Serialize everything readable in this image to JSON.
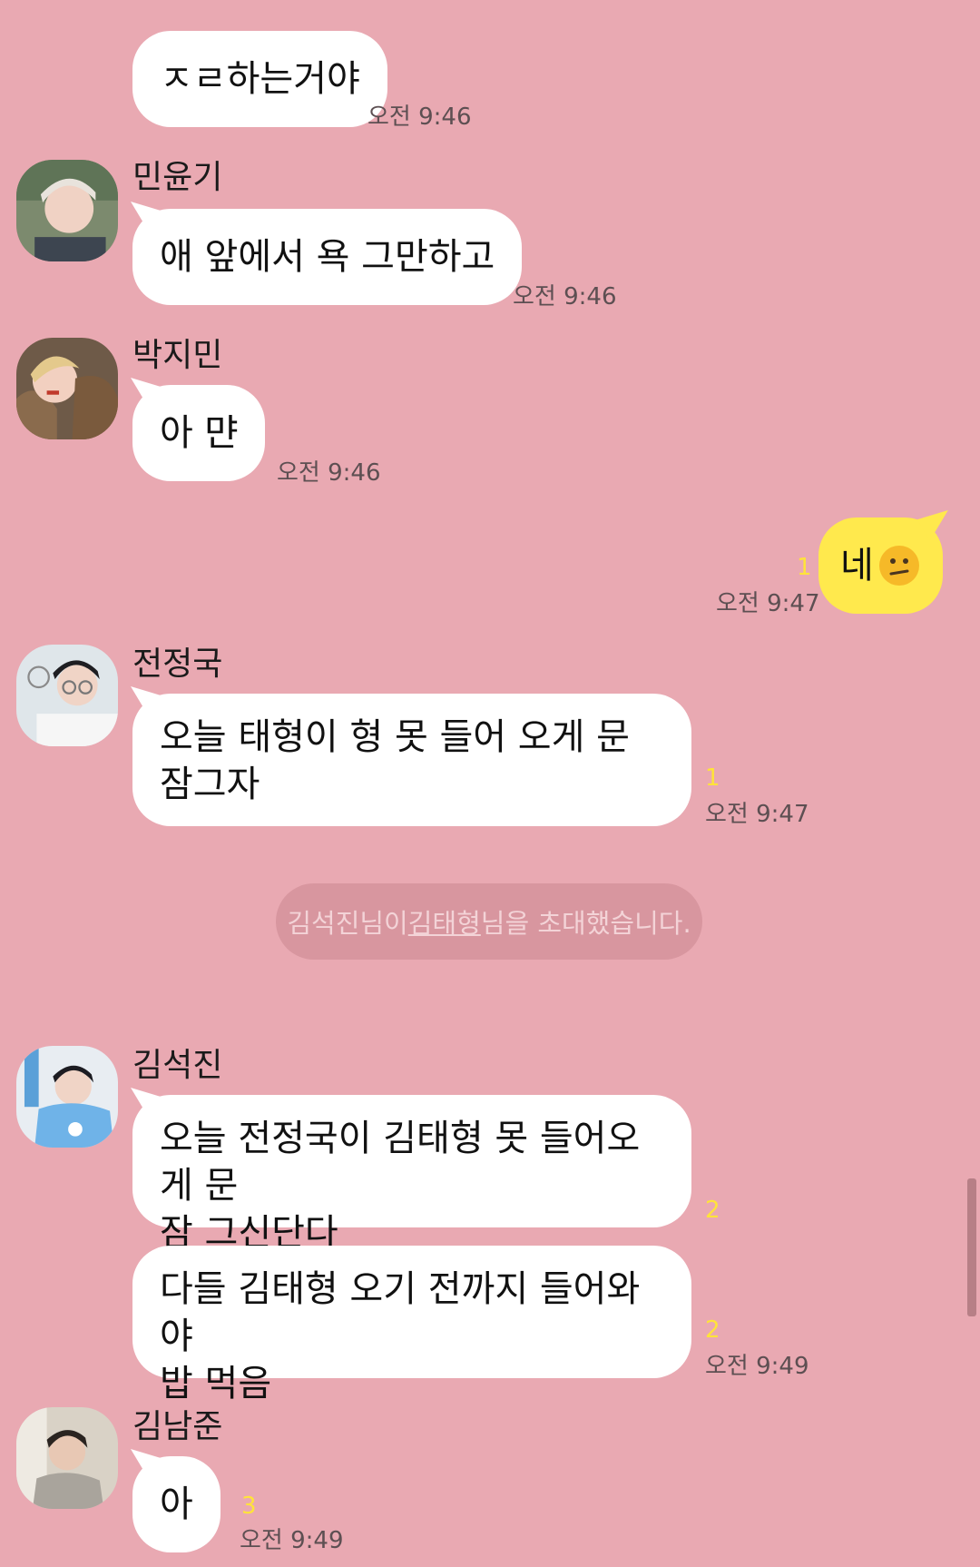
{
  "messages": [
    {
      "text": "ㅈㄹ하는거야",
      "time": "오전 9:46"
    },
    {
      "sender": "민윤기",
      "text": "애 앞에서 욕 그만하고",
      "time": "오전 9:46"
    },
    {
      "sender": "박지민",
      "text": "아 먄",
      "time": "오전 9:46"
    },
    {
      "text": "네",
      "emoji": "confused-face-icon",
      "unread": "1",
      "time": "오전 9:47",
      "mine": true
    },
    {
      "sender": "전정국",
      "line1": "오늘 태형이 형 못 들어 오게 문",
      "line2": "잠그자",
      "unread": "1",
      "time": "오전 9:47"
    },
    {
      "sender": "김석진",
      "line1": "오늘 전정국이 김태형 못 들어오게 문",
      "line2": "잠 그신단다",
      "unread": "2"
    },
    {
      "line1": "다들 김태형 오기 전까지 들어와야",
      "line2": "밥 먹음",
      "unread": "2",
      "time": "오전 9:49"
    },
    {
      "sender": "김남준",
      "text": "아",
      "unread": "3",
      "time": "오전 9:49"
    }
  ],
  "notice": {
    "before": "김석진님이 ",
    "highlight": "김태형",
    "after": "님을 초대했습니다."
  },
  "colors": {
    "background": "#e9a9b2",
    "bubble_other": "#ffffff",
    "bubble_mine": "#ffe94d",
    "unread": "#ffe33a"
  }
}
